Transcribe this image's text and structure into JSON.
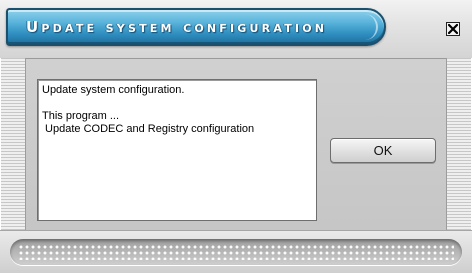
{
  "window": {
    "title": "Update system configuration",
    "close_icon": "close-x-icon"
  },
  "message": {
    "lines": [
      "Update system configuration.",
      "",
      "This program ...",
      " Update CODEC and Registry configuration"
    ]
  },
  "buttons": {
    "ok_label": "OK"
  },
  "colors": {
    "title_bar_blue": "#3a97c7",
    "window_gray": "#d0d0d0",
    "message_background": "#ffffff"
  }
}
